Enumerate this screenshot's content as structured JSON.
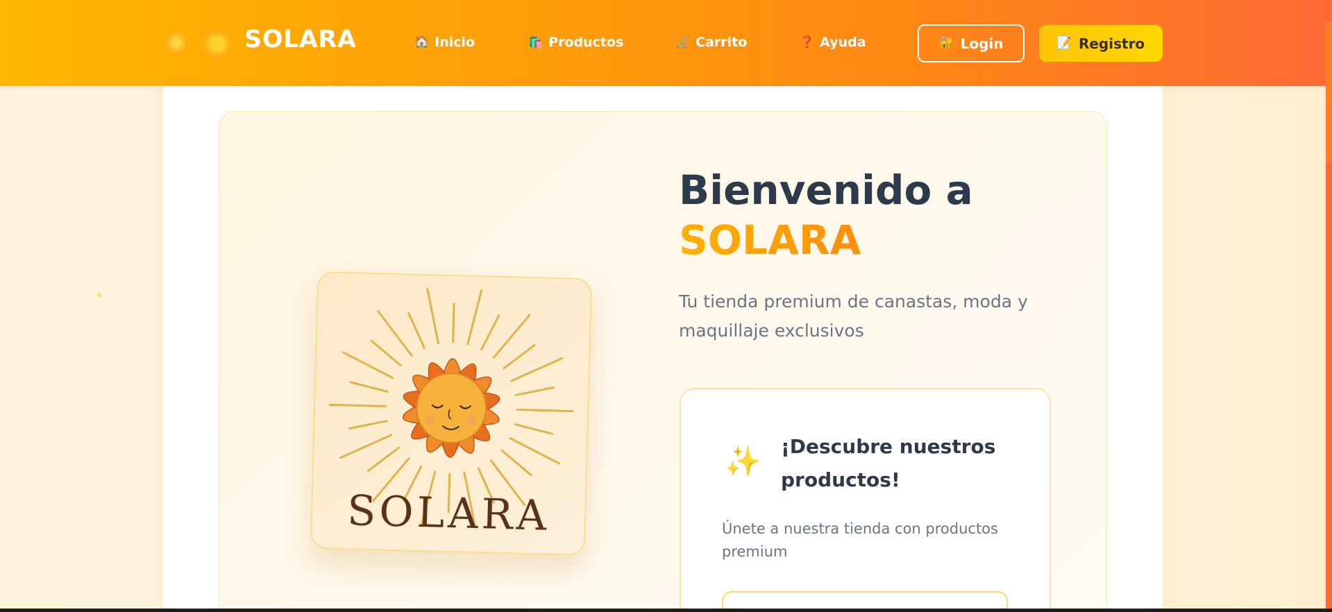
{
  "brand": {
    "name": "SOLARA",
    "logo_icon": "sun-icon"
  },
  "nav": {
    "items": [
      {
        "label": "Inicio",
        "icon": "🏠"
      },
      {
        "label": "Productos",
        "icon": "🛍️"
      },
      {
        "label": "Carrito",
        "icon": "🛒"
      },
      {
        "label": "Ayuda",
        "icon": "❓"
      }
    ],
    "login_label": "Login",
    "login_icon": "🔐",
    "register_label": "Registro",
    "register_icon": "📝"
  },
  "hero": {
    "title_line1": "Bienvenido a",
    "title_accent": "SOLARA",
    "subtitle": "Tu tienda premium de canastas, moda y maquillaje exclusivos",
    "logo_text": "SOLARA"
  },
  "promo": {
    "icon": "✨",
    "title": "¡Descubre nuestros productos!",
    "text": "Únete a nuestra tienda con productos premium"
  },
  "colors": {
    "header_start": "#ffb700",
    "header_end": "#ff6a35",
    "accent": "#ff8a14",
    "title_text": "#2c3a4c",
    "body_text": "#6a7483",
    "register_bg": "#ffd700"
  }
}
